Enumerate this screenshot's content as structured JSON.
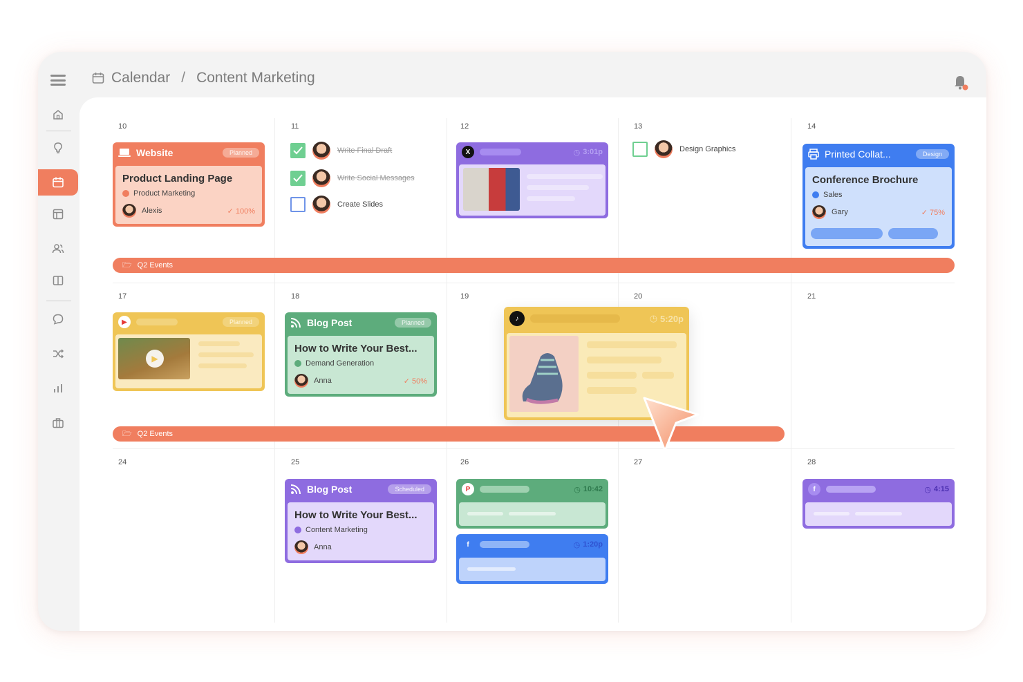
{
  "header": {
    "breadcrumb": [
      "Calendar",
      "Content Marketing"
    ],
    "separator": "/"
  },
  "sidebar": {
    "items": [
      "home-icon",
      "lightbulb-icon",
      "calendar-icon",
      "layout-icon",
      "users-icon",
      "columns-icon",
      "chat-icon",
      "shuffle-icon",
      "chart-icon",
      "briefcase-icon"
    ],
    "active": "calendar-icon"
  },
  "colors": {
    "accent": "#f07e5f",
    "green": "#5dac7c",
    "purple": "#8e6ce0",
    "blue": "#3f7df0",
    "yellow": "#efc556"
  },
  "calendar": {
    "days": {
      "d10": "10",
      "d11": "11",
      "d12": "12",
      "d13": "13",
      "d14": "14",
      "d17": "17",
      "d18": "18",
      "d19": "19",
      "d20": "20",
      "d21": "21",
      "d24": "24",
      "d25": "25",
      "d26": "26",
      "d27": "27",
      "d28": "28"
    },
    "bands": {
      "week1": "Q2 Events",
      "week2": "Q2 Events"
    },
    "website_card": {
      "type": "Website",
      "status": "Planned",
      "title": "Product Landing Page",
      "category": "Product Marketing",
      "owner": "Alexis",
      "progress": "100%"
    },
    "tasks": [
      {
        "label": "Write Final Draft",
        "done": true
      },
      {
        "label": "Write Social Messages",
        "done": true
      },
      {
        "label": "Create Slides",
        "done": false
      }
    ],
    "x_card": {
      "network": "X",
      "time": "3:01p"
    },
    "design_task": {
      "label": "Design Graphics",
      "done": false
    },
    "print_card": {
      "type": "Printed Collat...",
      "status": "Design",
      "title": "Conference Brochure",
      "category": "Sales",
      "owner": "Gary",
      "progress": "75%"
    },
    "youtube_card": {
      "status": "Planned"
    },
    "blog_card_1": {
      "type": "Blog Post",
      "status": "Planned",
      "title": "How to Write Your Best...",
      "category": "Demand Generation",
      "owner": "Anna",
      "progress": "50%"
    },
    "tiktok_card": {
      "time": "5:20p"
    },
    "blog_card_2": {
      "type": "Blog Post",
      "status": "Scheduled",
      "title": "How to Write Your Best...",
      "category": "Content Marketing",
      "owner": "Anna"
    },
    "pinterest_card": {
      "time": "10:42"
    },
    "facebook_card_1": {
      "time": "1:20p"
    },
    "facebook_card_2": {
      "time": "4:15"
    }
  }
}
